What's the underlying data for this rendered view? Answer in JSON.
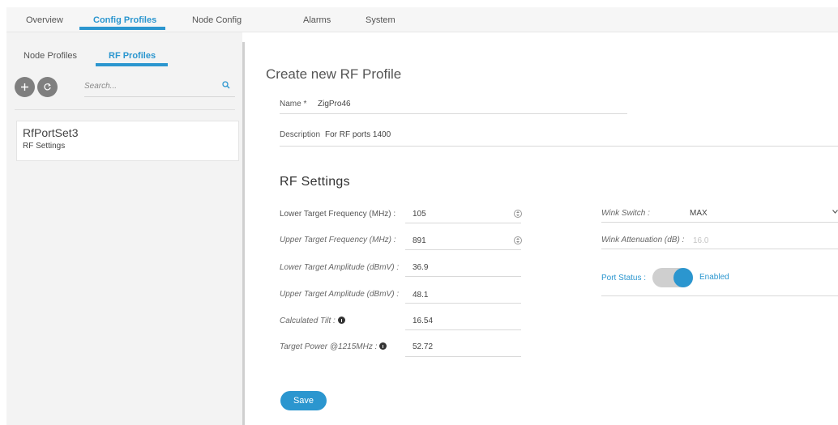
{
  "nav": {
    "tabs": [
      {
        "label": "Overview"
      },
      {
        "label": "Config Profiles"
      },
      {
        "label": "Node Config"
      },
      {
        "label": "Alarms"
      },
      {
        "label": "System"
      }
    ]
  },
  "sidebar": {
    "tabs": [
      {
        "label": "Node Profiles"
      },
      {
        "label": "RF Profiles"
      }
    ],
    "search_placeholder": "Search...",
    "profiles": [
      {
        "name": "RfPortSet3",
        "subtitle": "RF Settings"
      }
    ]
  },
  "form": {
    "title": "Create new RF Profile",
    "name_label": "Name *",
    "name_value": "ZigPro46",
    "description_label": "Description",
    "description_value": "For RF ports 1400"
  },
  "rf_settings": {
    "title": "RF Settings",
    "fields": [
      {
        "label": "Lower Target Frequency (MHz) :",
        "value": "105"
      },
      {
        "label": "Upper Target Frequency (MHz) :",
        "value": "891"
      },
      {
        "label": "Lower Target Amplitude (dBmV) :",
        "value": "36.9"
      },
      {
        "label": "Upper Target Amplitude (dBmV) :",
        "value": "48.1"
      },
      {
        "label": "Calculated Tilt :",
        "value": "16.54"
      },
      {
        "label": "Target Power @1215MHz :",
        "value": "52.72"
      }
    ],
    "wink_switch_label": "Wink Switch :",
    "wink_switch_value": "MAX",
    "wink_attenuation_label": "Wink Attenuation (dB) :",
    "wink_attenuation_value": "16.0",
    "port_status_label": "Port Status :",
    "port_status_value": "Enabled",
    "port_status_enabled": true
  },
  "actions": {
    "save_label": "Save"
  },
  "colors": {
    "accent": "#2b96cf",
    "sidebar_bg": "#f3f3f3"
  }
}
